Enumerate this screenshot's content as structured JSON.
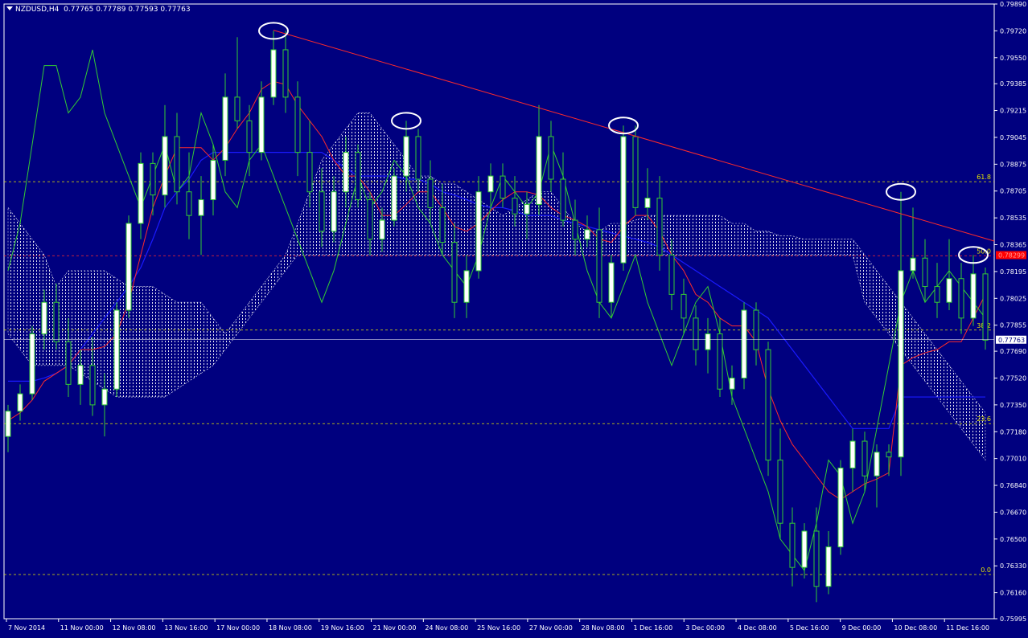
{
  "header": {
    "symbol": "NZDUSD,H4",
    "ohlc": "0.77765 0.77789 0.77593 0.77763"
  },
  "colors": {
    "bg": "#00007f",
    "frame": "#ffffff",
    "bull": "#ffffff",
    "bear": "#00007f",
    "wick": "#33cc33",
    "tenkan": "#ff2a2a",
    "kijun": "#1a1aff",
    "chikou": "#33cc33",
    "cloud": "#ffffff",
    "fib": "#e6e600",
    "trend": "#ff2a2a",
    "mark": "#ffffff",
    "last_bg": "#ffffff",
    "last_fg": "#00007f",
    "bid_bg": "#ff0000"
  },
  "chart_data": {
    "type": "candlestick",
    "ylim": [
      0.75995,
      0.7989
    ],
    "y_ticks": [
      "0.79890",
      "0.79720",
      "0.79550",
      "0.79385",
      "0.79215",
      "0.79045",
      "0.78875",
      "0.78705",
      "0.78535",
      "0.78365",
      "0.78195",
      "0.78025",
      "0.77855",
      "0.77690",
      "0.77520",
      "0.77350",
      "0.77180",
      "0.77010",
      "0.76840",
      "0.76670",
      "0.76500",
      "0.76330",
      "0.76160",
      "0.75995"
    ],
    "x_labels": [
      "7 Nov 2014",
      "11 Nov 00:00",
      "12 Nov 08:00",
      "13 Nov 16:00",
      "17 Nov 00:00",
      "18 Nov 08:00",
      "19 Nov 16:00",
      "21 Nov 00:00",
      "24 Nov 08:00",
      "25 Nov 16:00",
      "27 Nov 00:00",
      "28 Nov 08:00",
      "1 Dec 16:00",
      "3 Dec 00:00",
      "4 Dec 08:00",
      "5 Dec 16:00",
      "9 Dec 00:00",
      "10 Dec 08:00",
      "11 Dec 16:00"
    ],
    "fib_levels": [
      {
        "label": "61.8",
        "value": 0.78764
      },
      {
        "label": "50.0",
        "value": 0.78295
      },
      {
        "label": "38.2",
        "value": 0.77824
      },
      {
        "label": "23.6",
        "value": 0.77231
      },
      {
        "label": "0.0",
        "value": 0.76275
      }
    ],
    "last_price": "0.77763",
    "bid_price": "0.78299",
    "trendline": [
      {
        "x": 0,
        "y": 0.79724
      },
      {
        "x": 1,
        "y": 0.78388
      }
    ],
    "candles_ohlc": [
      [
        0.7715,
        0.7735,
        0.7705,
        0.7731
      ],
      [
        0.7731,
        0.7748,
        0.7725,
        0.7742
      ],
      [
        0.7742,
        0.7785,
        0.7738,
        0.778
      ],
      [
        0.778,
        0.7808,
        0.777,
        0.78
      ],
      [
        0.78,
        0.7812,
        0.777,
        0.7775
      ],
      [
        0.7775,
        0.779,
        0.774,
        0.7748
      ],
      [
        0.7748,
        0.777,
        0.7735,
        0.776
      ],
      [
        0.776,
        0.7778,
        0.7728,
        0.7735
      ],
      [
        0.7735,
        0.7755,
        0.7715,
        0.7745
      ],
      [
        0.7745,
        0.78,
        0.774,
        0.7795
      ],
      [
        0.7795,
        0.7855,
        0.779,
        0.785
      ],
      [
        0.785,
        0.7895,
        0.784,
        0.7888
      ],
      [
        0.7888,
        0.7895,
        0.7855,
        0.7868
      ],
      [
        0.7868,
        0.7925,
        0.786,
        0.7905
      ],
      [
        0.7905,
        0.792,
        0.7862,
        0.787
      ],
      [
        0.787,
        0.7895,
        0.784,
        0.7855
      ],
      [
        0.7855,
        0.788,
        0.783,
        0.7865
      ],
      [
        0.7865,
        0.79,
        0.7855,
        0.789
      ],
      [
        0.789,
        0.7945,
        0.788,
        0.793
      ],
      [
        0.793,
        0.7968,
        0.791,
        0.7915
      ],
      [
        0.7915,
        0.7925,
        0.788,
        0.7895
      ],
      [
        0.7895,
        0.794,
        0.789,
        0.793
      ],
      [
        0.793,
        0.7972,
        0.7925,
        0.796
      ],
      [
        0.796,
        0.7972,
        0.792,
        0.793
      ],
      [
        0.793,
        0.794,
        0.788,
        0.7895
      ],
      [
        0.7895,
        0.7915,
        0.786,
        0.787
      ],
      [
        0.787,
        0.7885,
        0.7835,
        0.7845
      ],
      [
        0.7845,
        0.788,
        0.7838,
        0.787
      ],
      [
        0.787,
        0.7905,
        0.786,
        0.7895
      ],
      [
        0.7895,
        0.79,
        0.786,
        0.7865
      ],
      [
        0.7865,
        0.787,
        0.783,
        0.784
      ],
      [
        0.784,
        0.786,
        0.7832,
        0.7852
      ],
      [
        0.7852,
        0.7885,
        0.7848,
        0.788
      ],
      [
        0.788,
        0.7915,
        0.787,
        0.7905
      ],
      [
        0.7905,
        0.791,
        0.787,
        0.7878
      ],
      [
        0.7878,
        0.789,
        0.785,
        0.786
      ],
      [
        0.786,
        0.7875,
        0.783,
        0.7838
      ],
      [
        0.7838,
        0.785,
        0.779,
        0.78
      ],
      [
        0.78,
        0.783,
        0.779,
        0.782
      ],
      [
        0.782,
        0.788,
        0.7815,
        0.787
      ],
      [
        0.787,
        0.7888,
        0.786,
        0.788
      ],
      [
        0.788,
        0.7888,
        0.786,
        0.7866
      ],
      [
        0.7866,
        0.788,
        0.7848,
        0.7856
      ],
      [
        0.7856,
        0.787,
        0.784,
        0.7862
      ],
      [
        0.7862,
        0.7925,
        0.7855,
        0.7905
      ],
      [
        0.7905,
        0.7915,
        0.787,
        0.7878
      ],
      [
        0.7878,
        0.7895,
        0.7848,
        0.7852
      ],
      [
        0.7852,
        0.7865,
        0.783,
        0.784
      ],
      [
        0.784,
        0.7855,
        0.7835,
        0.7846
      ],
      [
        0.7846,
        0.786,
        0.779,
        0.78
      ],
      [
        0.78,
        0.783,
        0.779,
        0.7825
      ],
      [
        0.7825,
        0.7912,
        0.782,
        0.7905
      ],
      [
        0.7905,
        0.7912,
        0.7855,
        0.786
      ],
      [
        0.786,
        0.7885,
        0.7852,
        0.7866
      ],
      [
        0.7866,
        0.788,
        0.782,
        0.783
      ],
      [
        0.783,
        0.784,
        0.7795,
        0.7805
      ],
      [
        0.7805,
        0.7815,
        0.778,
        0.779
      ],
      [
        0.779,
        0.7798,
        0.776,
        0.777
      ],
      [
        0.777,
        0.779,
        0.7755,
        0.778
      ],
      [
        0.778,
        0.779,
        0.774,
        0.7745
      ],
      [
        0.7745,
        0.776,
        0.7735,
        0.7752
      ],
      [
        0.7752,
        0.78,
        0.7745,
        0.7795
      ],
      [
        0.7795,
        0.78,
        0.776,
        0.777
      ],
      [
        0.777,
        0.7775,
        0.769,
        0.77
      ],
      [
        0.77,
        0.772,
        0.765,
        0.766
      ],
      [
        0.766,
        0.767,
        0.762,
        0.7632
      ],
      [
        0.7632,
        0.766,
        0.7625,
        0.7655
      ],
      [
        0.7655,
        0.767,
        0.761,
        0.762
      ],
      [
        0.762,
        0.7655,
        0.7615,
        0.7645
      ],
      [
        0.7645,
        0.77,
        0.764,
        0.7695
      ],
      [
        0.7695,
        0.772,
        0.768,
        0.7712
      ],
      [
        0.7712,
        0.7718,
        0.768,
        0.769
      ],
      [
        0.769,
        0.771,
        0.767,
        0.7705
      ],
      [
        0.7705,
        0.771,
        0.769,
        0.7702
      ],
      [
        0.7702,
        0.787,
        0.769,
        0.782
      ],
      [
        0.782,
        0.786,
        0.7815,
        0.7828
      ],
      [
        0.7828,
        0.784,
        0.78,
        0.781
      ],
      [
        0.781,
        0.7825,
        0.779,
        0.78
      ],
      [
        0.78,
        0.784,
        0.7795,
        0.7815
      ],
      [
        0.7815,
        0.7825,
        0.778,
        0.779
      ],
      [
        0.779,
        0.783,
        0.7785,
        0.7818
      ],
      [
        0.7818,
        0.7822,
        0.777,
        0.7776
      ]
    ],
    "tenkan": [
      0.7725,
      0.773,
      0.7738,
      0.775,
      0.7755,
      0.776,
      0.777,
      0.777,
      0.7772,
      0.778,
      0.78,
      0.783,
      0.786,
      0.788,
      0.7898,
      0.7898,
      0.7898,
      0.789,
      0.7898,
      0.791,
      0.792,
      0.7935,
      0.794,
      0.7938,
      0.7925,
      0.7915,
      0.7905,
      0.789,
      0.788,
      0.788,
      0.787,
      0.7855,
      0.7855,
      0.7862,
      0.787,
      0.787,
      0.786,
      0.7848,
      0.7845,
      0.785,
      0.7858,
      0.7865,
      0.787,
      0.787,
      0.7868,
      0.786,
      0.7855,
      0.7852,
      0.7848,
      0.784,
      0.7838,
      0.7848,
      0.7855,
      0.7855,
      0.7845,
      0.783,
      0.782,
      0.7805,
      0.78,
      0.779,
      0.7785,
      0.7785,
      0.7775,
      0.7745,
      0.7725,
      0.771,
      0.77,
      0.769,
      0.768,
      0.7675,
      0.768,
      0.7685,
      0.7688,
      0.7692,
      0.776,
      0.7765,
      0.7768,
      0.777,
      0.7775,
      0.7775,
      0.779,
      0.7805
    ],
    "kijun": [
      0.775,
      0.775,
      0.775,
      0.7752,
      0.7755,
      0.776,
      0.777,
      0.778,
      0.779,
      0.78,
      0.781,
      0.7822,
      0.784,
      0.786,
      0.787,
      0.7878,
      0.789,
      0.7895,
      0.7895,
      0.7895,
      0.7895,
      0.7895,
      0.7895,
      0.7895,
      0.7895,
      0.7895,
      0.7895,
      0.789,
      0.7885,
      0.788,
      0.788,
      0.788,
      0.788,
      0.7878,
      0.7878,
      0.7875,
      0.787,
      0.7868,
      0.7865,
      0.7862,
      0.786,
      0.786,
      0.7858,
      0.7855,
      0.7855,
      0.7855,
      0.7852,
      0.785,
      0.7848,
      0.7846,
      0.7844,
      0.7842,
      0.784,
      0.7838,
      0.7835,
      0.783,
      0.7825,
      0.782,
      0.7815,
      0.781,
      0.7805,
      0.78,
      0.7795,
      0.779,
      0.778,
      0.777,
      0.776,
      0.775,
      0.774,
      0.773,
      0.772,
      0.772,
      0.772,
      0.772,
      0.774,
      0.774,
      0.774,
      0.774,
      0.774,
      0.774,
      0.774,
      0.774
    ],
    "chikou": [
      0.782,
      0.785,
      0.79,
      0.795,
      0.795,
      0.792,
      0.793,
      0.796,
      0.792,
      0.79,
      0.788,
      0.786,
      0.788,
      0.79,
      0.787,
      0.788,
      0.792,
      0.79,
      0.787,
      0.786,
      0.789,
      0.79,
      0.788,
      0.786,
      0.784,
      0.782,
      0.78,
      0.782,
      0.785,
      0.788,
      0.786,
      0.787,
      0.789,
      0.788,
      0.786,
      0.785,
      0.783,
      0.782,
      0.781,
      0.783,
      0.786,
      0.788,
      0.787,
      0.786,
      0.787,
      0.79,
      0.788,
      0.785,
      0.782,
      0.78,
      0.779,
      0.781,
      0.783,
      0.78,
      0.778,
      0.776,
      0.778,
      0.78,
      0.781,
      0.778,
      0.774,
      0.772,
      0.77,
      0.768,
      0.765,
      0.764,
      0.763,
      0.766,
      0.77,
      0.769,
      0.766,
      0.768,
      0.772,
      0.776,
      0.78,
      0.782,
      0.78,
      0.781,
      0.782,
      0.781,
      0.78,
      0.779
    ],
    "cloud_top": [
      0.786,
      0.785,
      0.784,
      0.783,
      0.781,
      0.782,
      0.782,
      0.782,
      0.782,
      0.7815,
      0.781,
      0.781,
      0.781,
      0.7805,
      0.78,
      0.78,
      0.78,
      0.779,
      0.778,
      0.779,
      0.78,
      0.781,
      0.782,
      0.783,
      0.785,
      0.787,
      0.789,
      0.79,
      0.791,
      0.792,
      0.792,
      0.791,
      0.79,
      0.789,
      0.788,
      0.788,
      0.7875,
      0.7875,
      0.787,
      0.7865,
      0.786,
      0.7855,
      0.786,
      0.7865,
      0.787,
      0.787,
      0.786,
      0.785,
      0.7845,
      0.7845,
      0.785,
      0.785,
      0.7852,
      0.7855,
      0.7855,
      0.7855,
      0.7855,
      0.7855,
      0.7855,
      0.7855,
      0.785,
      0.785,
      0.7845,
      0.7845,
      0.7842,
      0.7842,
      0.784,
      0.784,
      0.784,
      0.784,
      0.784,
      0.783,
      0.782,
      0.781,
      0.78,
      0.779,
      0.778,
      0.777,
      0.776,
      0.775,
      0.774,
      0.773
    ],
    "cloud_bottom": [
      0.778,
      0.777,
      0.776,
      0.776,
      0.776,
      0.776,
      0.7755,
      0.775,
      0.7745,
      0.774,
      0.774,
      0.774,
      0.774,
      0.774,
      0.7745,
      0.775,
      0.7755,
      0.776,
      0.777,
      0.778,
      0.779,
      0.78,
      0.781,
      0.782,
      0.783,
      0.783,
      0.783,
      0.783,
      0.783,
      0.783,
      0.783,
      0.783,
      0.783,
      0.783,
      0.783,
      0.783,
      0.783,
      0.783,
      0.783,
      0.783,
      0.783,
      0.783,
      0.783,
      0.783,
      0.783,
      0.783,
      0.783,
      0.783,
      0.783,
      0.783,
      0.783,
      0.783,
      0.783,
      0.783,
      0.783,
      0.783,
      0.783,
      0.783,
      0.783,
      0.783,
      0.783,
      0.783,
      0.783,
      0.783,
      0.783,
      0.783,
      0.783,
      0.783,
      0.783,
      0.783,
      0.783,
      0.78,
      0.779,
      0.778,
      0.777,
      0.776,
      0.775,
      0.774,
      0.773,
      0.772,
      0.771,
      0.77
    ],
    "marked_points": [
      {
        "i": 22
      },
      {
        "i": 33
      },
      {
        "i": 51
      },
      {
        "i": 74
      },
      {
        "i": 80
      }
    ]
  }
}
